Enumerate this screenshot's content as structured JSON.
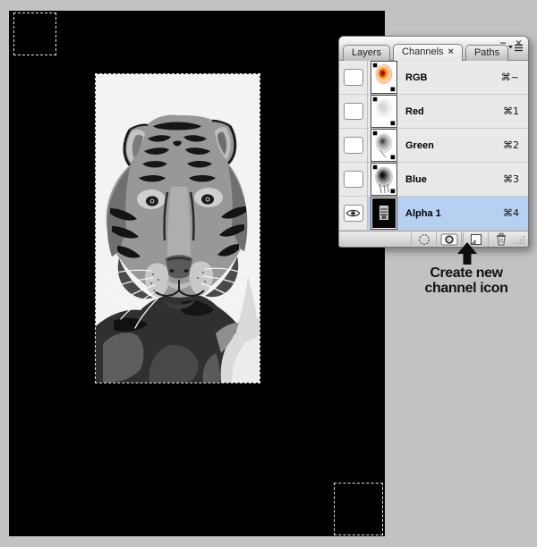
{
  "page": {
    "background_color": "#c2c2c2",
    "annotation": {
      "line1": "Create new",
      "line2": "channel icon"
    }
  },
  "canvas": {
    "background_color": "#000000",
    "content": "grayscale posterized tiger portrait inside rectangular selection marquee; two small square marquees at top-left and bottom-right of canvas"
  },
  "panel": {
    "window": {
      "minimize_glyph": "−",
      "close_glyph": "×"
    },
    "tabs": [
      {
        "label": "Layers",
        "active": false
      },
      {
        "label": "Channels",
        "active": true,
        "close_glyph": "×"
      },
      {
        "label": "Paths",
        "active": false
      }
    ],
    "channels": [
      {
        "name": "RGB",
        "shortcut": "⌘~",
        "visible": false,
        "selected": false,
        "thumb": "rgb-color-tiger"
      },
      {
        "name": "Red",
        "shortcut": "⌘1",
        "visible": false,
        "selected": false,
        "thumb": "red-channel-light"
      },
      {
        "name": "Green",
        "shortcut": "⌘2",
        "visible": false,
        "selected": false,
        "thumb": "green-channel-mid"
      },
      {
        "name": "Blue",
        "shortcut": "⌘3",
        "visible": false,
        "selected": false,
        "thumb": "blue-channel-dark"
      },
      {
        "name": "Alpha 1",
        "shortcut": "⌘4",
        "visible": true,
        "selected": true,
        "thumb": "alpha-black-tiger"
      }
    ],
    "footer_icons": [
      "load-channel-as-selection",
      "save-selection-as-channel",
      "create-new-channel",
      "delete-channel"
    ],
    "colors": {
      "selected_row": "#b6d0f2",
      "row_background": "#e9e9e9"
    }
  }
}
